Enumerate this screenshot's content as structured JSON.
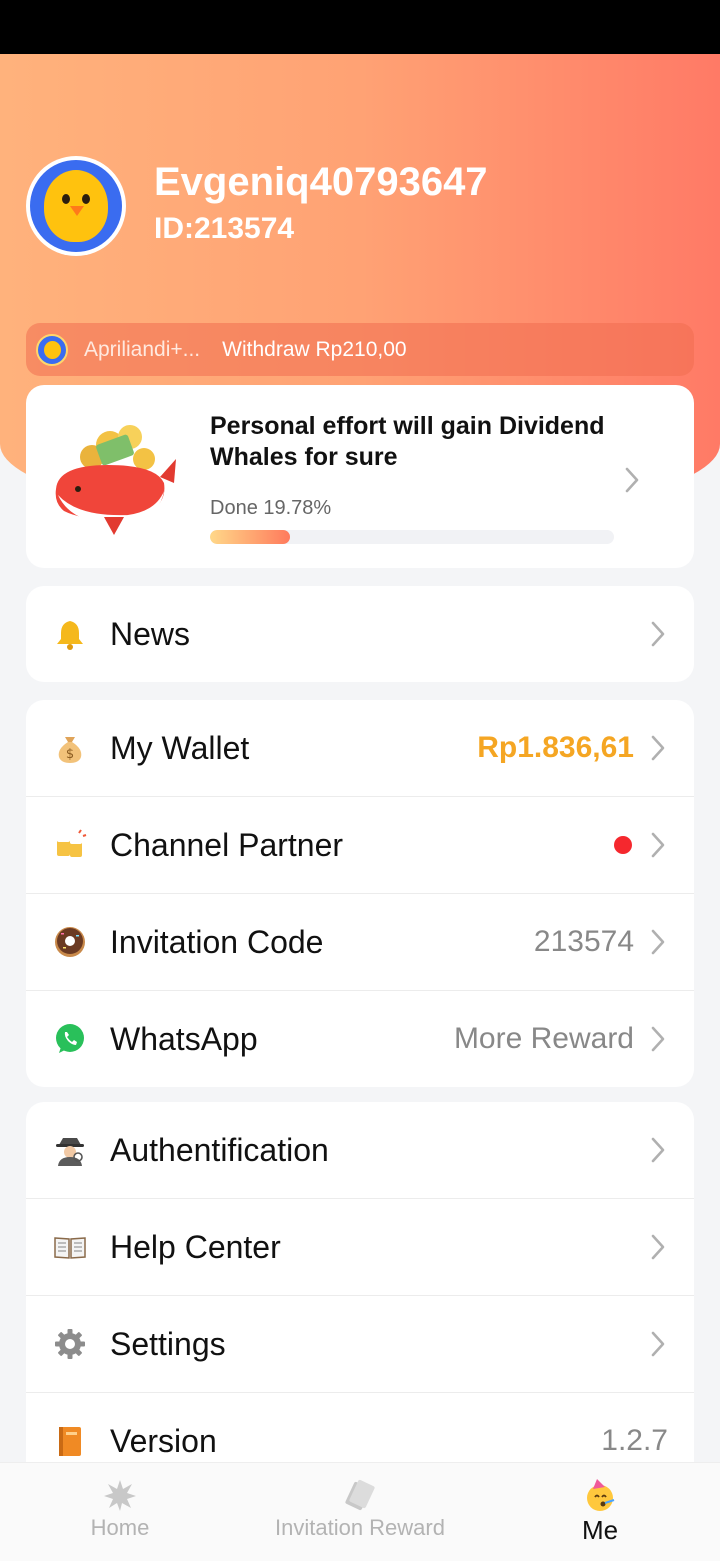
{
  "profile": {
    "username": "Evgeniq40793647",
    "id_text": "ID:213574"
  },
  "ticker": {
    "name": "Apriliandi+...",
    "message": "Withdraw Rp210,00"
  },
  "goal": {
    "title": "Personal effort will gain Dividend Whales for sure",
    "progress_text": "Done 19.78%",
    "progress_fraction": 0.1978
  },
  "news": {
    "label": "News",
    "icon": "bell-icon"
  },
  "menu_primary": [
    {
      "label": "My Wallet",
      "value": "Rp1.836,61",
      "icon": "money-bag-icon"
    },
    {
      "label": "Channel Partner",
      "value": "",
      "icon": "beer-mugs-icon",
      "badge": true
    },
    {
      "label": "Invitation Code",
      "value": "213574",
      "icon": "donut-icon"
    },
    {
      "label": "WhatsApp",
      "value": "More Reward",
      "icon": "whatsapp-icon"
    }
  ],
  "menu_secondary": [
    {
      "label": "Authentification",
      "icon": "detective-icon"
    },
    {
      "label": "Help Center",
      "icon": "open-book-icon"
    },
    {
      "label": "Settings",
      "icon": "gear-icon"
    },
    {
      "label": "Version",
      "value": "1.2.7",
      "icon": "orange-book-icon"
    }
  ],
  "tabs": [
    {
      "label": "Home",
      "icon": "star-burst-icon",
      "active": false
    },
    {
      "label": "Invitation Reward",
      "icon": "cash-bills-icon",
      "active": false
    },
    {
      "label": "Me",
      "icon": "party-face-icon",
      "active": true
    }
  ],
  "colors": {
    "accent_orange": "#f5a623",
    "badge_red": "#f5282e",
    "hero_start": "#ffb27c",
    "hero_end": "#ff7a66"
  }
}
